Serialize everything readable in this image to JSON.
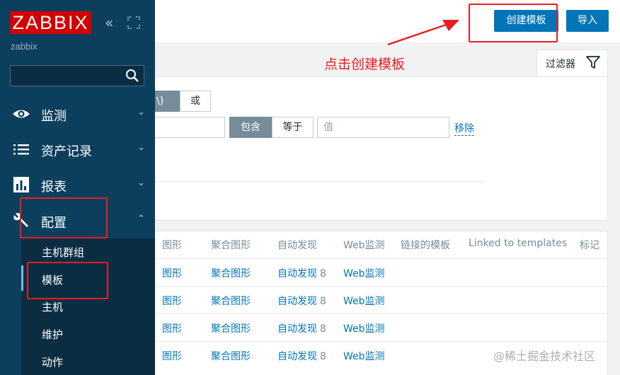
{
  "sidebar": {
    "logo": "ZABBIX",
    "server_name": "zabbix",
    "collapse_glyph": "«",
    "menu": [
      {
        "label": "监测",
        "icon": "eye-icon",
        "chevron": "⌄"
      },
      {
        "label": "资产记录",
        "icon": "list-icon",
        "chevron": "⌄"
      },
      {
        "label": "报表",
        "icon": "bar-chart-icon",
        "chevron": "⌄"
      },
      {
        "label": "配置",
        "icon": "wrench-icon",
        "chevron": "⌃"
      }
    ],
    "submenu": [
      "主机群组",
      "模板",
      "主机",
      "维护",
      "动作"
    ]
  },
  "header": {
    "create_button": "创建模板",
    "import_button": "导入"
  },
  "filter": {
    "tab_label": "过滤器",
    "and_label": "\\)",
    "or_label": "或",
    "contains_label": "包含",
    "equals_label": "等于",
    "value_placeholder": "值",
    "remove_label": "移除"
  },
  "table": {
    "columns": [
      "图形",
      "聚合图形",
      "自动发现",
      "Web监测",
      "链接的模板",
      "Linked to templates",
      "标记"
    ],
    "rows": [
      {
        "graphs": "图形",
        "screens": "聚合图形",
        "discovery": "自动发现",
        "discovery_count": "8",
        "web": "Web监测"
      },
      {
        "graphs": "图形",
        "screens": "聚合图形",
        "discovery": "自动发现",
        "discovery_count": "8",
        "web": "Web监测"
      },
      {
        "graphs": "图形",
        "screens": "聚合图形",
        "discovery": "自动发现",
        "discovery_count": "8",
        "web": "Web监测"
      },
      {
        "graphs": "图形",
        "screens": "聚合图形",
        "discovery": "自动发现",
        "discovery_count": "8",
        "web": "Web监测"
      }
    ]
  },
  "annotation": {
    "text": "点击创建模板",
    "color": "#ec1c24"
  },
  "watermark": "@稀土掘金技术社区",
  "colors": {
    "sidebar_bg": "#0c3f5e",
    "logo_red": "#d40000",
    "primary_blue": "#0275b8",
    "segment_active": "#768d99"
  }
}
